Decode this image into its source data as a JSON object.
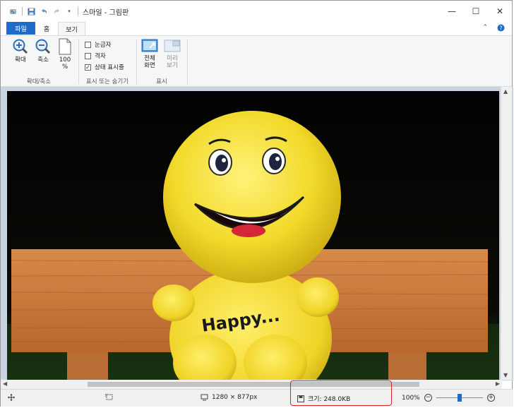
{
  "window": {
    "title": "스마일 - 그림판",
    "minimize_glyph": "—",
    "maximize_glyph": "☐",
    "close_glyph": "✕"
  },
  "tabs": [
    {
      "label": "파일"
    },
    {
      "label": "홈"
    },
    {
      "label": "보기"
    }
  ],
  "ribbon": {
    "zoom_group": {
      "label": "확대/축소",
      "zoom_in": "확대",
      "zoom_out": "축소",
      "actual_size_line1": "100",
      "actual_size_line2": "%"
    },
    "show_hide_group": {
      "label": "표시 또는 숨기기",
      "rulers": {
        "label": "눈금자",
        "checked": false
      },
      "gridlines": {
        "label": "격자",
        "checked": false
      },
      "status_bar": {
        "label": "상태 표시줄",
        "checked": true
      }
    },
    "display_group": {
      "label": "표시",
      "fullscreen_line1": "전체",
      "fullscreen_line2": "화면",
      "thumbnail_line1": "미리",
      "thumbnail_line2": "보기"
    }
  },
  "image": {
    "subject": "yellow smiley plush toy on wooden bench",
    "shirt_text": "Happy..."
  },
  "status_bar": {
    "dimensions": "1280 × 877px",
    "size": "크기: 248.0KB",
    "zoom": "100%",
    "zoom_level_fraction": 0.5
  },
  "colors": {
    "accent": "#1e6bc9",
    "highlight_box": "#d8232a"
  }
}
